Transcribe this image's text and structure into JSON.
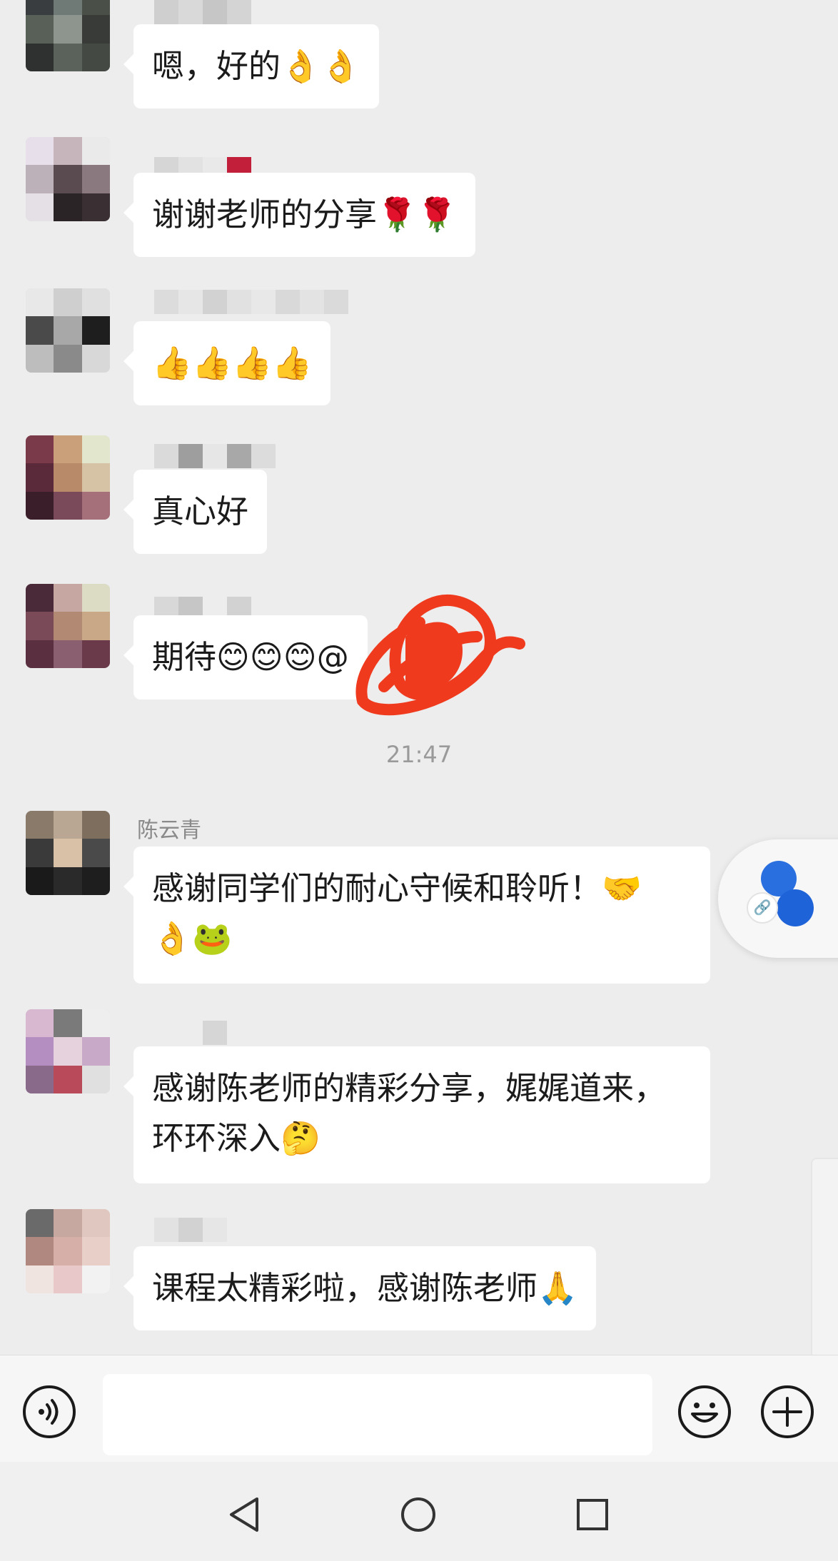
{
  "chat": {
    "messages": [
      {
        "sender": "",
        "text": "嗯，好的",
        "emoji": "👌👌"
      },
      {
        "sender": "",
        "text": "谢谢老师的分享",
        "emoji": "🌹🌹"
      },
      {
        "sender": "",
        "text": "",
        "emoji": "👍👍👍👍"
      },
      {
        "sender": "",
        "text": "真心好",
        "emoji": ""
      },
      {
        "sender": "",
        "text": "期待",
        "emoji": "😊😊😊",
        "mention": "@"
      },
      {
        "sender": "陈云青",
        "text": "感谢同学们的耐心守候和聆听！",
        "emoji": "🤝",
        "line2_emoji": "👌🐸"
      },
      {
        "sender": "",
        "text": "感谢陈老师的精彩分享，娓娓道来，",
        "line2": "环环深入",
        "line2_emoji": "🤔"
      },
      {
        "sender": "",
        "text": "课程太精彩啦，感谢陈老师",
        "emoji": "🙏"
      }
    ],
    "timestamp": "21:47"
  },
  "icons": {
    "voice": "voice-input-icon",
    "emoji": "emoji-icon",
    "plus": "plus-icon",
    "float": "floating-music-icon",
    "back": "back-triangle-icon",
    "home": "home-circle-icon",
    "recent": "recent-square-icon"
  },
  "colors": {
    "background": "#ededed",
    "bubble": "#ffffff",
    "scribble": "#f03a1e",
    "float_accent": "#2a6fe0"
  }
}
